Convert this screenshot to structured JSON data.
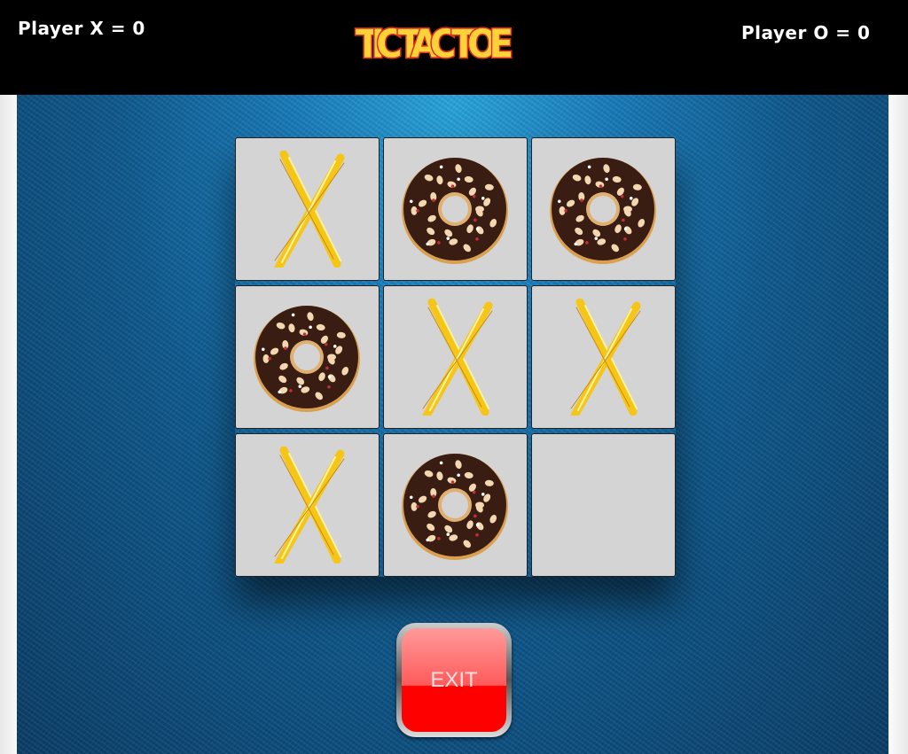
{
  "header": {
    "score_x": "Player X = 0",
    "score_o": "Player O = 0",
    "logo_text": "TIC TAC TOE"
  },
  "board": {
    "cells": [
      "X",
      "O",
      "O",
      "O",
      "X",
      "X",
      "X",
      "O",
      ""
    ]
  },
  "exit_label": "EXIT",
  "colors": {
    "x": "#f5c518",
    "donut_icing": "#3a1d12",
    "donut_dough": "#d9a04f",
    "cell": "#d4d4d4"
  }
}
